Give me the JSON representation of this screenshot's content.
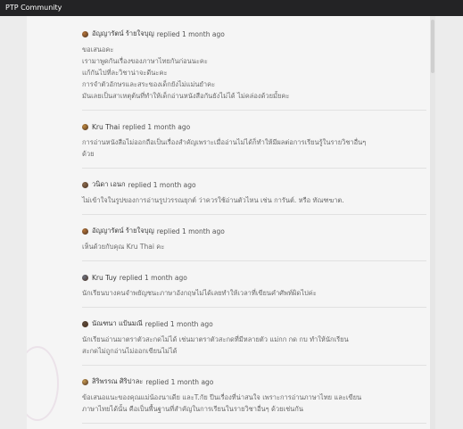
{
  "topbar": {
    "title": "PTP Community"
  },
  "comments": [
    {
      "author": "อัญญารัตน์ ร้ายใจบุญ",
      "meta": "replied 1 month ago",
      "lines": [
        "ขอเสนอคะ",
        "เรามาพูดกันเรื่องของภาษาไทยกันก่อนนะคะ",
        "แก้กันไปที่ละวิชาน่าจะดีนะคะ",
        "การจำตัวอักษรและสระของเด็กยังไม่แม่นยำคะ",
        "มันเลยเป็นสาเหตุต้นที่ทำให้เด็กอ่านหนังสือกันยังไม่ได้ ไม่คล่องด้วยมั้ยคะ"
      ]
    },
    {
      "author": "Kru Thai",
      "meta": "replied 1 month ago",
      "lines": [
        "การอ่านหนังสือไม่ออกถือเป็นเรื่องสำคัญเพราะเมื่ออ่านไม่ได้ก็ทำให้มีผลต่อการเรียนรู้ในรายวิชาอื่นๆ",
        "ด้วย"
      ]
    },
    {
      "author": "วนิดา เอนก",
      "meta": "replied 1 month ago",
      "lines": [
        "ไม่เข้าใจในรูปของการอ่านรูปวรรณยุกต์ ว่าควรใช้อ่านตัวไหน เช่น การันต์. หรือ ทัณฑฆาต."
      ]
    },
    {
      "author": "อัญญารัตน์ ร้ายใจบุญ",
      "meta": "replied 1 month ago",
      "lines": [
        "เห็นด้วยกับคุณ Kru Thai คะ"
      ]
    },
    {
      "author": "Kru Tuy",
      "meta": "replied 1 month ago",
      "lines": [
        "นักเรียนบางคนจำพยัญชนะภาษาอังกฤษไม่ได้เลยทำให้เวลาที่เขียนคำศัพท์ผิดไปค่ะ"
      ]
    },
    {
      "author": "นัณฑนา แป้นมณี",
      "meta": "replied 1 month ago",
      "lines": [
        "นักเรียนอ่านมาตราตัวสะกดไม่ได้ เช่นมาตราตัวสะกดที่มีหลายตัว แม่กก กด กบ ทำให้นักเรียน",
        "สะกดไม่ถูกอ่านไม่ออกเขียนไม่ได้"
      ]
    },
    {
      "author": "สิริพรรณ ศิริปาละ",
      "meta": "replied 1 month ago",
      "lines": [
        "ข้อเสนอแนะของคุณแม่น้องนาเดีย และT.กัย ปีนเรื่องที่น่าสนใจ เพราะการอ่านภาษาไทย และเขียน",
        "ภาษาไทยได้นั้น คือเป็นพื้นฐานที่สำคัญในการเรียนในรายวิชาอื่นๆ ด้วยเช่นกัน"
      ]
    }
  ]
}
